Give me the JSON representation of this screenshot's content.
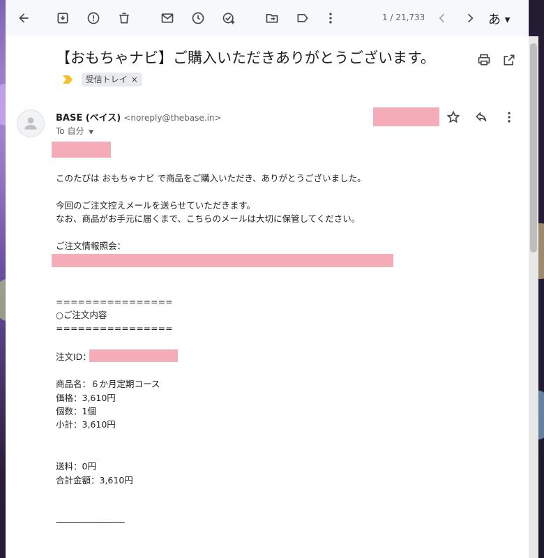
{
  "toolbar": {
    "icons": [
      "back-arrow-icon",
      "archive-icon",
      "report-spam-icon",
      "delete-icon",
      "mark-unread-icon",
      "snooze-icon",
      "add-task-icon",
      "move-to-icon",
      "label-icon",
      "more-vert-icon",
      "newer-icon",
      "older-icon"
    ],
    "pager": "1 / 21,733",
    "ime": "あ"
  },
  "email": {
    "subject": "【おもちゃナビ】ご購入いただきありがとうございます。",
    "label": "受信トレイ",
    "label_close": "×",
    "sender_name": "BASE (ベイス)",
    "sender_addr": "<noreply@thebase.in>",
    "to": "To 自分",
    "body": {
      "p1": "このたびは おもちゃナビ で商品をご購入いただき、ありがとうございました。",
      "p2a": "今回のご注文控えメールを送らせていただきます。",
      "p2b": "なお、商品がお手元に届くまで、こちらのメールは大切に保管してください。",
      "inquiry": "ご注文情報照会：",
      "sep1": "================",
      "section": "○ご注文内容",
      "sep2": "================",
      "order_id": "注文ID：",
      "product": "商品名：６か月定期コース",
      "price": "価格：3,610円",
      "qty": "個数：1個",
      "subtotal": "小計：3,610円",
      "shipping": "送料：0円",
      "total": "合計金額：3,610円",
      "sep3": "----------------------------"
    }
  },
  "colors": {
    "redaction": "#f4adb8",
    "label_arrow": "#f6c026"
  }
}
